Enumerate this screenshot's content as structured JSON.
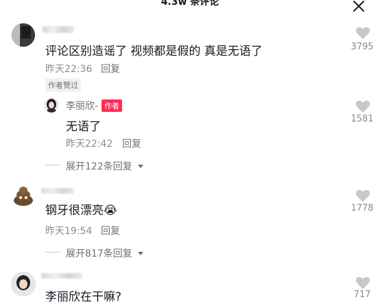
{
  "header": {
    "title": "4.3w 条评论"
  },
  "comments": [
    {
      "text": "评论区别造谣了 视频都是假的 真是无语了",
      "time": "昨天22:36",
      "reply_label": "回复",
      "author_liked": "作者赞过",
      "likes": "3795"
    },
    {
      "author_name": "李丽欣-",
      "author_tag": "作者",
      "text": "无语了",
      "time": "昨天22:42",
      "reply_label": "回复",
      "likes": "1581",
      "expand_label": "展开122条回复"
    },
    {
      "text": "钢牙很漂亮",
      "emoji": "😭",
      "time": "昨天19:54",
      "reply_label": "回复",
      "likes": "1778",
      "expand_label": "展开817条回复"
    },
    {
      "text": "李丽欣在干嘛?",
      "likes": "717"
    }
  ],
  "icons": {
    "heart": "heart-icon",
    "close": "close-icon",
    "chevron": "chevron-down-icon"
  },
  "colors": {
    "author_tag_bg": "#fe2c55",
    "heart": "#c8c8cc"
  }
}
